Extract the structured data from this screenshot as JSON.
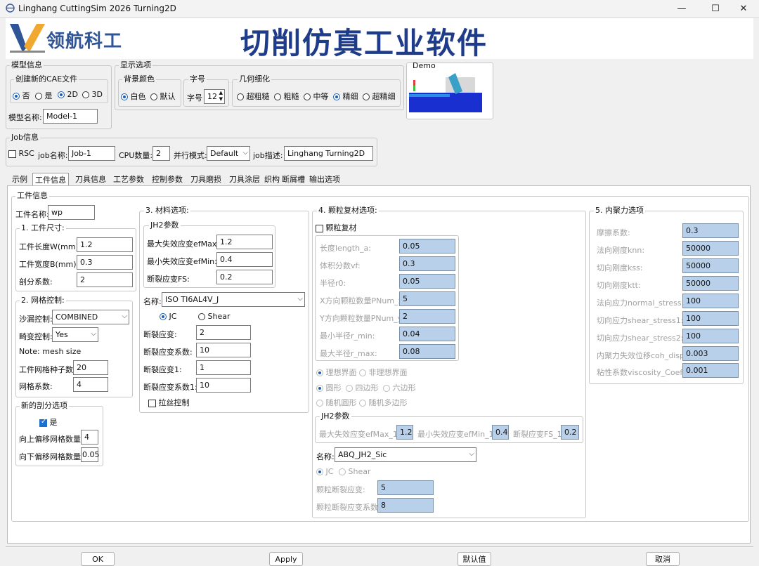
{
  "window": {
    "title": "Linghang CuttingSim 2026 Turning2D",
    "minimize": "—",
    "maximize": "☐",
    "close": "✕"
  },
  "banner": {
    "logo_text": "领航科工",
    "title": "切削仿真工业软件"
  },
  "model_info": {
    "group": "模型信息",
    "cae_group": "创建新的CAE文件",
    "cae_opts": [
      "否",
      "是",
      "2D",
      "3D"
    ],
    "name_label": "模型名称:",
    "name_value": "Model-1"
  },
  "display": {
    "group": "显示选项",
    "bg_group": "背景颜色",
    "bg_opts": [
      "白色",
      "默认"
    ],
    "font_group": "字号",
    "font_label": "字号",
    "font_value": "12",
    "geom_group": "几何细化",
    "geom_opts": [
      "超粗糙",
      "粗糙",
      "中等",
      "精细",
      "超精细"
    ]
  },
  "demo": {
    "label": "Demo"
  },
  "job": {
    "group": "Job信息",
    "rsc": "RSC",
    "name_label": "job名称:",
    "name_value": "Job-1",
    "cpu_label": "CPU数量:",
    "cpu_value": "2",
    "mode_label": "并行模式:",
    "mode_value": "Default",
    "desc_label": "job描述:",
    "desc_value": "Linghang Turning2D"
  },
  "tabs": [
    "示例",
    "工件信息",
    "刀具信息",
    "工艺参数",
    "控制参数",
    "刀具磨损",
    "刀具涂层",
    "织构",
    "断屑槽",
    "输出选项"
  ],
  "workpiece": {
    "group": "工件信息",
    "name_label": "工件名称:",
    "name_value": "wp",
    "size_group": "1. 工件尺寸:",
    "length_label": "工件长度W(mm):",
    "length_value": "1.2",
    "width_label": "工件宽度B(mm):",
    "width_value": "0.3",
    "div_label": "剖分系数:",
    "div_value": "2",
    "mesh_group": "2. 网格控制:",
    "hourglass_label": "沙漏控制:",
    "hourglass_value": "COMBINED",
    "distort_label": "畸变控制:",
    "distort_value": "Yes",
    "note": "Note: mesh size",
    "seed_label": "工件网格种子数:",
    "seed_value": "20",
    "mesh_coef_label": "网格系数:",
    "mesh_coef_value": "4",
    "new_div_group": "新的剖分选项",
    "new_div_yes": "是",
    "up_label": "向上偏移网格数量:",
    "up_value": "4",
    "down_label": "向下偏移网格数量:",
    "down_value": "0.05"
  },
  "material": {
    "group": "3. 材料选项:",
    "jh2_group": "JH2参数",
    "efmax_label": "最大失效应变efMax:",
    "efmax_value": "1.2",
    "efmin_label": "最小失效应变efMin:",
    "efmin_value": "0.4",
    "fs_label": "断裂应变FS:",
    "fs_value": "0.2",
    "name_label": "名称:",
    "name_value": "ISO TI6AL4V_J",
    "model_opts": [
      "JC",
      "Shear"
    ],
    "rows": [
      {
        "label": "断裂应变:",
        "value": "2"
      },
      {
        "label": "断裂应变系数:",
        "value": "10"
      },
      {
        "label": "断裂应变1:",
        "value": "1"
      },
      {
        "label": "断裂应变系数1:",
        "value": "10"
      }
    ],
    "wire": "拉丝控制"
  },
  "particle": {
    "group": "4. 颗粒复材选项:",
    "enable": "颗粒复材",
    "rows": [
      {
        "label": "长度length_a:",
        "value": "0.05"
      },
      {
        "label": "体积分数vf:",
        "value": "0.3"
      },
      {
        "label": "半径r0:",
        "value": "0.05"
      },
      {
        "label": "X方向颗粒数量PNum_x:",
        "value": "5"
      },
      {
        "label": "Y方向颗粒数量PNum_y:",
        "value": "2"
      },
      {
        "label": "最小半径r_min:",
        "value": "0.04"
      },
      {
        "label": "最大半径r_max:",
        "value": "0.08"
      }
    ],
    "iface_opts": [
      "理想界面",
      "非理想界面"
    ],
    "shape_opts": [
      "圆形",
      "四边形",
      "六边形"
    ],
    "rand_opts": [
      "随机圆形",
      "随机多边形"
    ],
    "jh2_group": "JH2参数",
    "efmax1_label": "最大失效应变efMax_1:",
    "efmax1_value": "1.2",
    "efmin1_label": "最小失效应变efMin_1:",
    "efmin1_value": "0.4",
    "fs1_label": "断裂应变FS_1:",
    "fs1_value": "0.2",
    "name_label": "名称:",
    "name_value": "ABQ_JH2_Sic",
    "model_opts": [
      "JC",
      "Shear"
    ],
    "pf_label": "颗粒断裂应变:",
    "pf_value": "5",
    "pfc_label": "颗粒断裂应变系数:",
    "pfc_value": "8"
  },
  "cohesive": {
    "group": "5. 内聚力选项",
    "rows": [
      {
        "label": "摩擦系数:",
        "value": "0.3"
      },
      {
        "label": "法向刚度knn:",
        "value": "50000"
      },
      {
        "label": "切向刚度kss:",
        "value": "50000"
      },
      {
        "label": "切向刚度ktt:",
        "value": "50000"
      },
      {
        "label": "法向应力normal_stress:",
        "value": "100"
      },
      {
        "label": "切向应力shear_stress1:",
        "value": "100"
      },
      {
        "label": "切向应力shear_stress2:",
        "value": "100"
      },
      {
        "label": "内聚力失效位移coh_disp:",
        "value": "0.003"
      },
      {
        "label": "粘性系数viscosity_Coef:",
        "value": "0.001"
      }
    ]
  },
  "buttons": {
    "ok": "OK",
    "apply": "Apply",
    "default": "默认值",
    "cancel": "取消"
  }
}
